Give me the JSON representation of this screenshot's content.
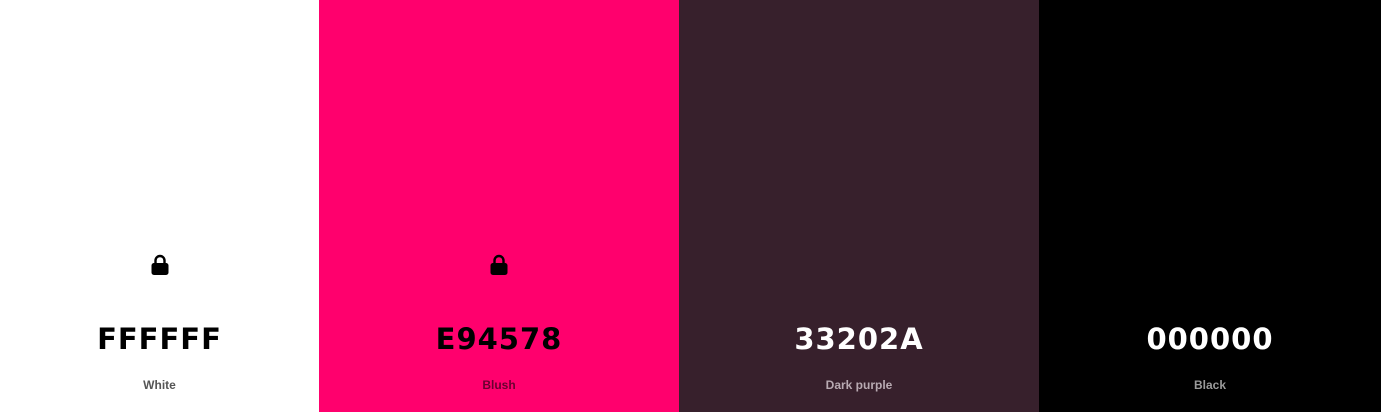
{
  "palette": {
    "swatches": [
      {
        "hex": "FFFFFF",
        "name": "White",
        "background": "#FFFFFF",
        "hex_color": "#000000",
        "name_color": "#555555",
        "locked": true,
        "icon": "lock-icon"
      },
      {
        "hex": "E94578",
        "name": "Blush",
        "background": "#FF006D",
        "hex_color": "#000000",
        "name_color": "#6a0030",
        "locked": true,
        "icon": "lock-icon"
      },
      {
        "hex": "33202A",
        "name": "Dark purple",
        "background": "#37202C",
        "hex_color": "#FFFFFF",
        "name_color": "#b8aab2",
        "locked": false
      },
      {
        "hex": "000000",
        "name": "Black",
        "background": "#000000",
        "hex_color": "#FFFFFF",
        "name_color": "#9a9a9a",
        "locked": false
      }
    ]
  }
}
